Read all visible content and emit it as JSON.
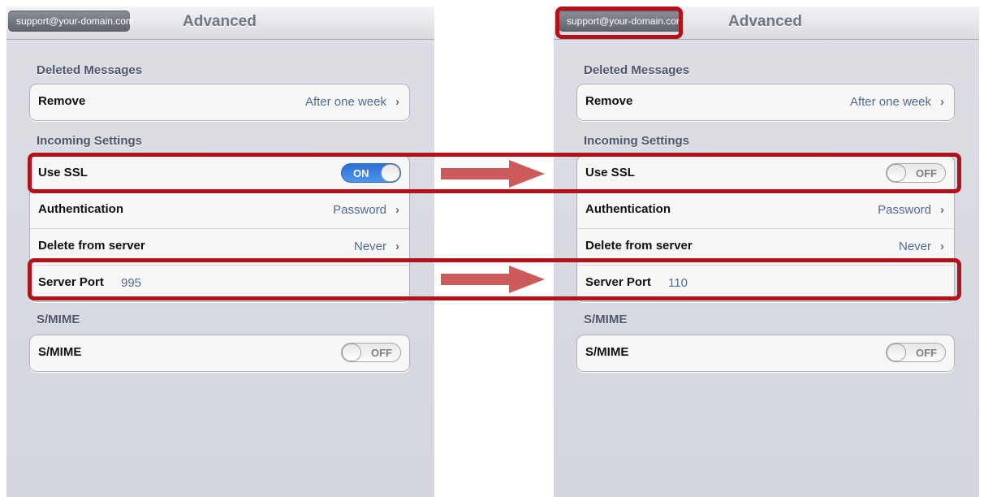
{
  "left_screen": {
    "back_button": "support@your-domain.com",
    "title": "Advanced",
    "deleted_messages": {
      "header": "Deleted Messages",
      "remove_label": "Remove",
      "remove_value": "After one week"
    },
    "incoming_settings": {
      "header": "Incoming Settings",
      "use_ssl_label": "Use SSL",
      "use_ssl_state": "ON",
      "authentication_label": "Authentication",
      "authentication_value": "Password",
      "delete_label": "Delete from server",
      "delete_value": "Never",
      "server_port_label": "Server Port",
      "server_port_value": "995"
    },
    "smime": {
      "header": "S/MIME",
      "label": "S/MIME",
      "state": "OFF"
    }
  },
  "right_screen": {
    "back_button": "support@your-domain.com",
    "title": "Advanced",
    "deleted_messages": {
      "header": "Deleted Messages",
      "remove_label": "Remove",
      "remove_value": "After one week"
    },
    "incoming_settings": {
      "header": "Incoming Settings",
      "use_ssl_label": "Use SSL",
      "use_ssl_state": "OFF",
      "authentication_label": "Authentication",
      "authentication_value": "Password",
      "delete_label": "Delete from server",
      "delete_value": "Never",
      "server_port_label": "Server Port",
      "server_port_value": "110"
    },
    "smime": {
      "header": "S/MIME",
      "label": "S/MIME",
      "state": "OFF"
    }
  },
  "icons": {
    "chevron": "›",
    "arrow": "right-arrow-icon"
  },
  "colors": {
    "highlight": "#b3121a",
    "arrow": "#cc5a5a",
    "toggle_on": "#2b6fd2",
    "value_text": "#4f6a94"
  }
}
